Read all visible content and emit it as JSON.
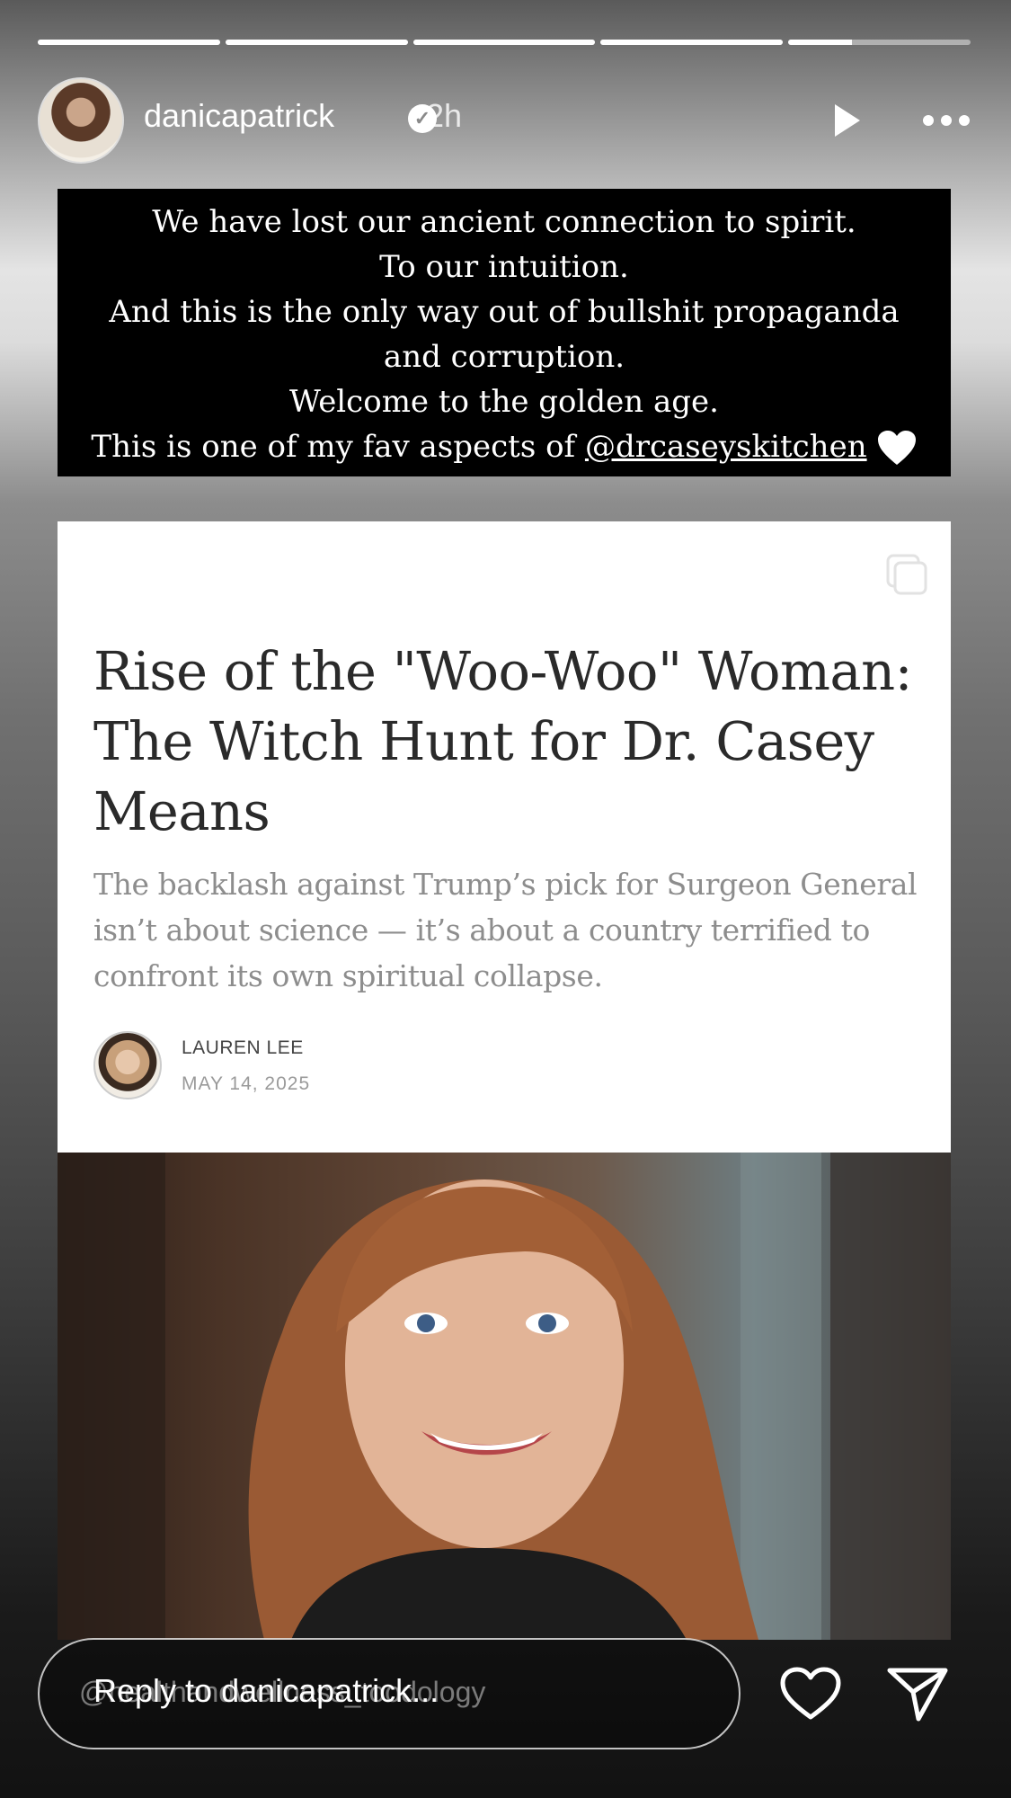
{
  "story": {
    "progress": [
      1,
      1,
      1,
      1,
      0.35
    ],
    "username": "danicapatrick",
    "time": "2h"
  },
  "caption": {
    "lines": [
      "We have lost our ancient connection to spirit.",
      "To our intuition.",
      "And this is the only way out of bullshit propaganda",
      "and corruption.",
      "Welcome to the golden age."
    ],
    "last_prefix": "This is one of my fav aspects of ",
    "mention": "@drcaseyskitchen"
  },
  "article": {
    "headline": "Rise of the \"Woo-Woo\" Woman: The Witch Hunt for Dr. Casey Means",
    "subhead": "The backlash against Trump’s pick for Surgeon General isn’t about science — it’s about a country terrified to confront its own spiritual collapse.",
    "author": "LAUREN LEE",
    "date": "MAY 14, 2025"
  },
  "reply": {
    "placeholder": "Reply to danicapatrick...",
    "ghost_text": "@healthandwellness_toodology"
  }
}
